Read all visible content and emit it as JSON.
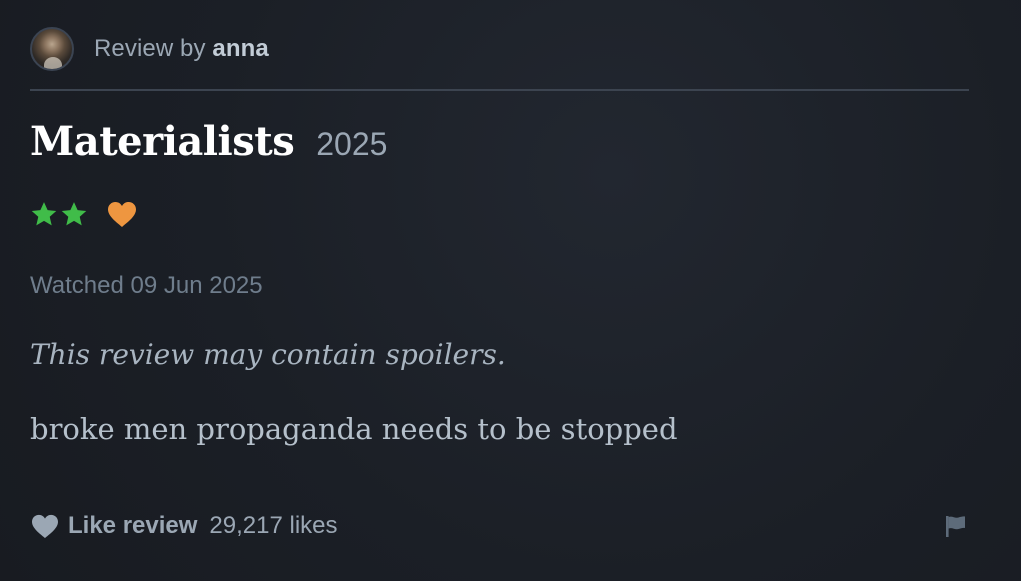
{
  "review": {
    "byline_prefix": "Review by ",
    "author": "anna",
    "film_title": "Materialists",
    "film_year": "2025",
    "rating_stars": 2,
    "liked": true,
    "watched_text": "Watched 09 Jun 2025",
    "spoiler_notice": "This review may contain spoilers.",
    "body": "broke men propaganda needs to be stopped"
  },
  "footer": {
    "like_label": "Like review",
    "like_count": "29,217 likes"
  },
  "colors": {
    "star": "#40bc49",
    "heart": "#ee9640",
    "muted": "#9ba7b4"
  },
  "icons": {
    "star": "star-icon",
    "liked": "heart-icon",
    "like_button": "heart-outline-icon",
    "report": "flag-icon"
  }
}
